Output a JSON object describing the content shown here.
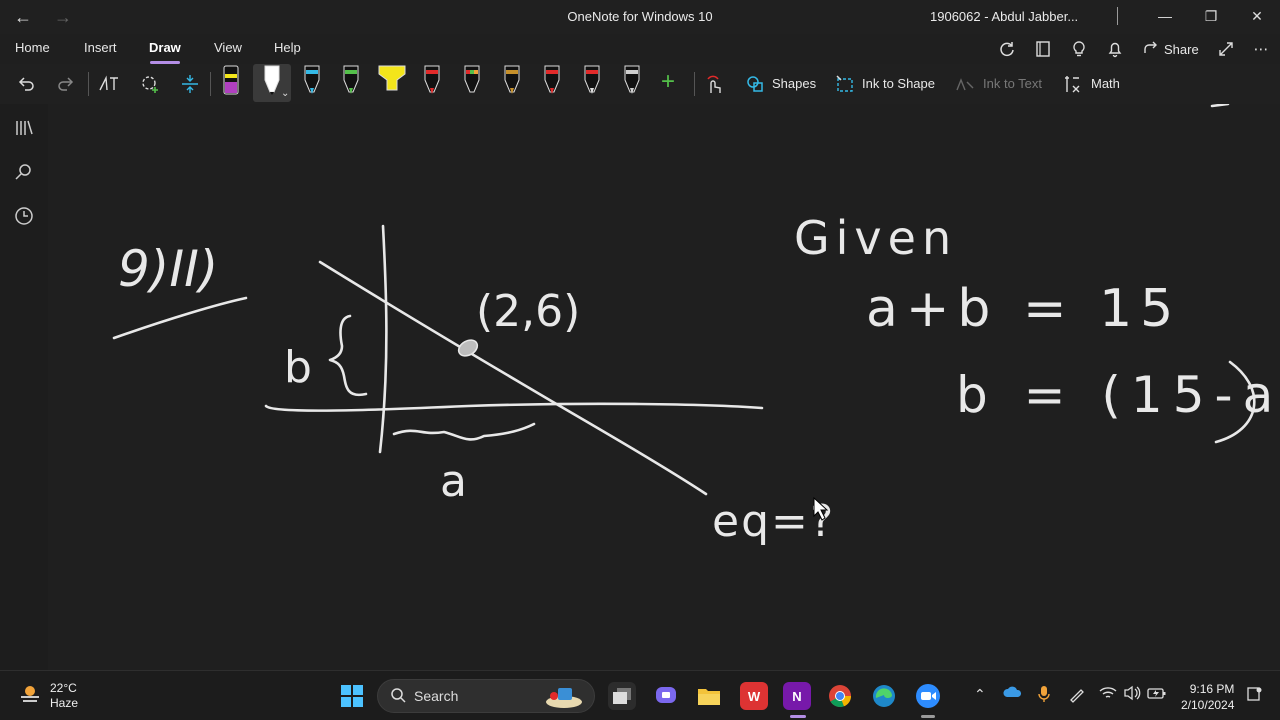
{
  "window": {
    "title": "OneNote for Windows 10",
    "user": "1906062 - Abdul Jabber...",
    "back_icon": "back-arrow-icon",
    "forward_icon": "forward-arrow-icon"
  },
  "ribbon": {
    "tabs": [
      "Home",
      "Insert",
      "Draw",
      "View",
      "Help"
    ],
    "active_tab": "Draw",
    "share_label": "Share"
  },
  "toolbar": {
    "shapes_label": "Shapes",
    "ink_to_shape_label": "Ink to Shape",
    "ink_to_text_label": "Ink to Text",
    "math_label": "Math",
    "pens": [
      {
        "name": "purple-highlighter",
        "color": "#b040c0"
      },
      {
        "name": "white-pen-selected",
        "color": "#ffffff"
      },
      {
        "name": "cyan-pen",
        "color": "#34b9e6"
      },
      {
        "name": "green-pen",
        "color": "#54c04a"
      },
      {
        "name": "yellow-highlighter",
        "color": "#f3e51b"
      },
      {
        "name": "red-pen",
        "color": "#e22a2a"
      },
      {
        "name": "multicolor-pen",
        "color": "#f1a33a"
      },
      {
        "name": "brown-pen",
        "color": "#c6902a"
      },
      {
        "name": "red-pen-2",
        "color": "#e22a2a"
      },
      {
        "name": "red-pen-3",
        "color": "#e22a2a"
      },
      {
        "name": "gray-pen",
        "color": "#cfcfcf"
      }
    ]
  },
  "notes": {
    "problem_label": "9)II)",
    "point_label": "(2,6)",
    "b_label": "b",
    "a_label": "a",
    "given_label": "Given",
    "eq1": "a+b = 15",
    "eq2": "b = (15-a)",
    "eq3": "eq=?"
  },
  "taskbar": {
    "temperature": "22°C",
    "weather": "Haze",
    "search_placeholder": "Search",
    "time": "9:16 PM",
    "date": "2/10/2024"
  }
}
